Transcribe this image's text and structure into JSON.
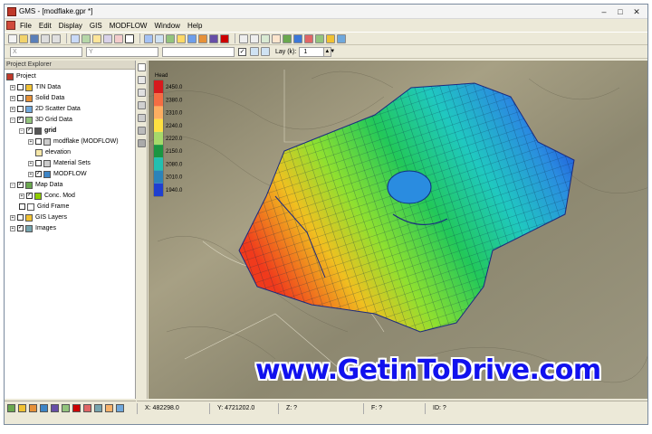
{
  "window": {
    "title": "GMS - [modflake.gpr *]"
  },
  "menu": [
    "File",
    "Edit",
    "Display",
    "GIS",
    "MODFLOW",
    "Window",
    "Help"
  ],
  "coordbar": {
    "x_label": "X",
    "y_label": "Y",
    "layer_label": "Lay (k):",
    "layer_value": "1"
  },
  "explorer": {
    "title": "Project Explorer",
    "items": [
      {
        "label": "Project",
        "icon": "project-icon",
        "color": "#c0392b"
      },
      {
        "label": "TIN Data",
        "icon": "tin-icon",
        "color": "#f1c232"
      },
      {
        "label": "Solid Data",
        "icon": "solid-icon",
        "color": "#e69138"
      },
      {
        "label": "2D Scatter Data",
        "icon": "scatter-icon",
        "color": "#6fa8dc"
      },
      {
        "label": "3D Grid Data",
        "icon": "grid3d-icon",
        "color": "#93c47d"
      },
      {
        "label": "grid",
        "icon": "grid-icon",
        "color": "#555555"
      },
      {
        "label": "modflake (MODFLOW)",
        "icon": "model-icon",
        "color": "#cccccc"
      },
      {
        "label": "elevation",
        "icon": "dataset-icon",
        "color": "#f6e7a8"
      },
      {
        "label": "Material Sets",
        "icon": "material-icon",
        "color": "#cccccc"
      },
      {
        "label": "MODFLOW",
        "icon": "modflow-icon",
        "color": "#3d85c6"
      },
      {
        "label": "Map Data",
        "icon": "map-icon",
        "color": "#6aa84f"
      },
      {
        "label": "Conc. Mod",
        "icon": "coverage-icon",
        "color": "#8fce00"
      },
      {
        "label": "Grid Frame",
        "icon": "gridframe-icon",
        "color": "#ffffff"
      },
      {
        "label": "GIS Layers",
        "icon": "gis-icon",
        "color": "#f1c232"
      },
      {
        "label": "Images",
        "icon": "images-icon",
        "color": "#76a5af"
      }
    ]
  },
  "legend": {
    "title": "Head",
    "values": [
      "2450.0",
      "2380.0",
      "2310.0",
      "2240.0",
      "2220.0",
      "2150.0",
      "2080.0",
      "2010.0",
      "1940.0"
    ],
    "colors": [
      "#d7191c",
      "#f46d43",
      "#fdae61",
      "#ffe040",
      "#a6d96a",
      "#1a9641",
      "#22c0b0",
      "#2b83ba",
      "#1f3fd0"
    ]
  },
  "status": {
    "x": "X: 482298.0",
    "y": "Y: 4721202.0",
    "z": "Z: ?",
    "f": "F: ?",
    "id": "ID: ?"
  },
  "watermark": "www.GetinToDrive.com"
}
